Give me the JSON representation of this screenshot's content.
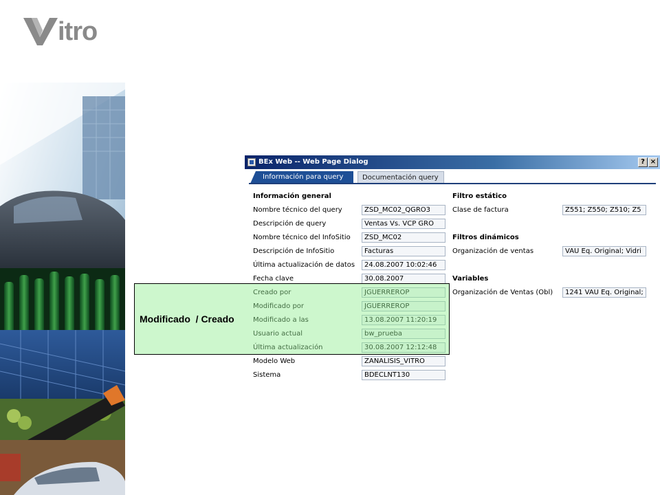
{
  "logo": {
    "text": "itro"
  },
  "dialog": {
    "title": "BEx Web -- Web Page Dialog",
    "help_button": "?",
    "close_button": "×",
    "tabs": [
      {
        "label": "Información para query",
        "active": true
      },
      {
        "label": "Documentación query",
        "active": false
      }
    ],
    "general": {
      "title": "Información general",
      "rows": [
        {
          "label": "Nombre técnico del query",
          "value": "ZSD_MC02_QGRO3"
        },
        {
          "label": "Descripción de query",
          "value": "Ventas Vs. VCP GRO"
        },
        {
          "label": "Nombre técnico del InfoSitio",
          "value": "ZSD_MC02"
        },
        {
          "label": "Descripción de InfoSitio",
          "value": "Facturas"
        },
        {
          "label": "Última actualización de datos",
          "value": "24.08.2007 10:02:46"
        },
        {
          "label": "Fecha clave",
          "value": "30.08.2007"
        },
        {
          "label": "Creado por",
          "value": "JGUERREROP"
        },
        {
          "label": "Modificado por",
          "value": "JGUERREROP"
        },
        {
          "label": "Modificado a las",
          "value": "13.08.2007 11:20:19"
        },
        {
          "label": "Usuario actual",
          "value": "bw_prueba"
        },
        {
          "label": "Última actualización",
          "value": "30.08.2007 12:12:48"
        },
        {
          "label": "Modelo Web",
          "value": "ZANALISIS_VITRO"
        },
        {
          "label": "Sistema",
          "value": "BDECLNT130"
        }
      ]
    },
    "static_filter": {
      "title": "Filtro estático",
      "rows": [
        {
          "label": "Clase de factura",
          "value": "Z551; Z550; Z510; Z5"
        }
      ]
    },
    "dynamic_filters": {
      "title": "Filtros dinámicos",
      "rows": [
        {
          "label": "Organización de ventas",
          "value": "VAU Eq. Original; Vidri"
        }
      ]
    },
    "variables": {
      "title": "Variables",
      "rows": [
        {
          "label": "Organización de Ventas (Obl)",
          "value": "1241 VAU Eq. Original;"
        }
      ]
    }
  },
  "highlight": {
    "label": "Modificado  / Creado"
  },
  "colors": {
    "titlebar_start": "#0a246a",
    "tab_active": "#1e4f96",
    "highlight_fill": "#90ee90",
    "logo_gray": "#8a8a8a"
  }
}
